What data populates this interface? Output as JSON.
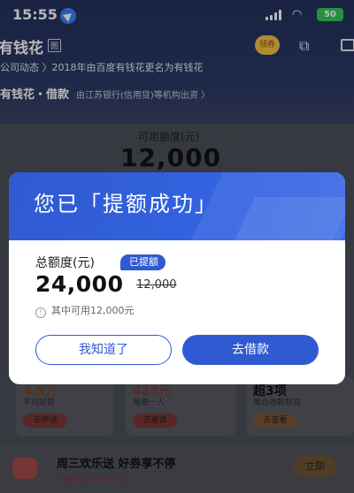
{
  "status": {
    "time": "15:55",
    "battery": "50"
  },
  "header": {
    "brand": "有钱花",
    "brand_tag": "图",
    "avatar_text": "领券"
  },
  "news": "公司动态 〉2018年由百度有钱花更名为有钱花",
  "product": {
    "name": "有钱花・借款",
    "desc": "由江苏银行(信用贷)等机构出资 〉"
  },
  "credit": {
    "label": "可用额度(元)",
    "amount": "12,000"
  },
  "promos": [
    {
      "big": "4.5万",
      "small": "平均提额",
      "button": "去申请"
    },
    {
      "big": "428元",
      "small": "每邀一人",
      "button": "去邀请"
    },
    {
      "big": "超3项",
      "small": "聚合收款权益",
      "button": "去查看"
    }
  ],
  "banner": {
    "title": "周三欢乐送 好券享不停",
    "subtitle": "海量权益等你来领",
    "button": "立即"
  },
  "modal": {
    "title": "您已「提额成功」",
    "total_label": "总额度(元)",
    "badge": "已提额",
    "new_amount": "24,000",
    "old_amount": "12,000",
    "info": "其中可用12,000元",
    "btn_know": "我知道了",
    "btn_borrow": "去借款",
    "accent": "#2f5ad1"
  }
}
